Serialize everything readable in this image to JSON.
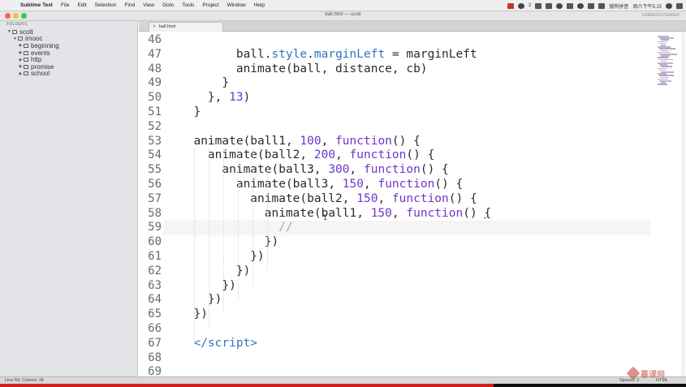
{
  "menubar": {
    "app": "Sublime Text",
    "items": [
      "File",
      "Edit",
      "Selection",
      "Find",
      "View",
      "Goto",
      "Tools",
      "Project",
      "Window",
      "Help"
    ],
    "status_text": "2",
    "input_method": "搜狗拼音",
    "clock": "周六下午5:15"
  },
  "window": {
    "title": "ball.html — scott",
    "unregistered": "UNREGISTERED"
  },
  "sidebar": {
    "header": "FOLDERS",
    "tree": [
      {
        "label": "scott",
        "level": 0,
        "expanded": true
      },
      {
        "label": "imooc",
        "level": 1,
        "expanded": true
      },
      {
        "label": "beginning",
        "level": 2,
        "expanded": false
      },
      {
        "label": "events",
        "level": 2,
        "expanded": false
      },
      {
        "label": "http",
        "level": 2,
        "expanded": false
      },
      {
        "label": "promise",
        "level": 2,
        "expanded": false
      },
      {
        "label": "school",
        "level": 2,
        "expanded": false
      }
    ]
  },
  "tabs": [
    {
      "label": "ball.html",
      "active": true
    }
  ],
  "editor": {
    "current_line": 59,
    "lines": [
      {
        "n": "46",
        "html": ""
      },
      {
        "n": "47",
        "html": "        ball.<span class=\"p\">style</span>.<span class=\"p\">marginLeft</span> = marginLeft"
      },
      {
        "n": "48",
        "html": "        animate(ball, distance, cb)"
      },
      {
        "n": "49",
        "html": "      }"
      },
      {
        "n": "50",
        "html": "    }, <span class=\"n\">13</span>)"
      },
      {
        "n": "51",
        "html": "  }"
      },
      {
        "n": "52",
        "html": ""
      },
      {
        "n": "53",
        "html": "  animate(ball1, <span class=\"n\">100</span>, <span class=\"k\">function</span>() {"
      },
      {
        "n": "54",
        "html": "    animate(ball2, <span class=\"n\">200</span>, <span class=\"k\">function</span>() {"
      },
      {
        "n": "55",
        "html": "      animate(ball3, <span class=\"n\">300</span>, <span class=\"k\">function</span>() {"
      },
      {
        "n": "56",
        "html": "        animate(ball3, <span class=\"n\">150</span>, <span class=\"k\">function</span>() {"
      },
      {
        "n": "57",
        "html": "          animate(ball2, <span class=\"n\">150</span>, <span class=\"k\">function</span>() {"
      },
      {
        "n": "58",
        "html": "            animate(ball1, <span class=\"n\">150</span>, <span class=\"k\">function</span>() <u>{</u>"
      },
      {
        "n": "59",
        "html": "              <span class=\"cm\">//</span>"
      },
      {
        "n": "60",
        "html": "            })"
      },
      {
        "n": "61",
        "html": "          })"
      },
      {
        "n": "62",
        "html": "        })"
      },
      {
        "n": "63",
        "html": "      })"
      },
      {
        "n": "64",
        "html": "    })"
      },
      {
        "n": "65",
        "html": "  })"
      },
      {
        "n": "66",
        "html": ""
      },
      {
        "n": "67",
        "html": "  <span class=\"tag\">&lt;/script&gt;</span>"
      },
      {
        "n": "68",
        "html": ""
      },
      {
        "n": "69",
        "html": ""
      }
    ]
  },
  "status": {
    "position": "Line 59, Column 18",
    "indent": "Spaces: 2",
    "syntax": "HTML"
  },
  "watermark": "慕课网",
  "video_progress": 0.72,
  "colors": {
    "keyword": "#6f36c9",
    "property": "#2f74c0",
    "progress": "#d0201c"
  }
}
